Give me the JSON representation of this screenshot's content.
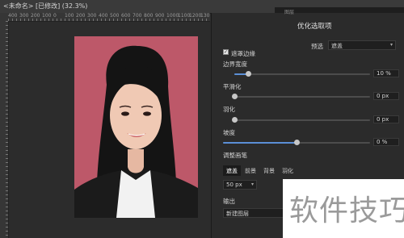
{
  "document": {
    "title": "<未命名> [已修改] (32.3%)"
  },
  "ruler": {
    "ticks": [
      "400",
      "300",
      "200",
      "100",
      "0",
      "100",
      "200",
      "300",
      "400",
      "500",
      "600",
      "700",
      "800",
      "900",
      "1000",
      "1100",
      "1200",
      "130"
    ]
  },
  "panel": {
    "tab_label": "图层"
  },
  "refine": {
    "title": "优化选取项",
    "preset_label": "预选",
    "preset_value": "遮盖",
    "matte_edges_label": "遮罩边缘",
    "matte_edges_checked": true,
    "sliders": [
      {
        "label": "边界宽度",
        "value_text": "10 %",
        "level": 0.1
      },
      {
        "label": "平滑化",
        "value_text": "0 px",
        "level": 0.0
      },
      {
        "label": "羽化",
        "value_text": "0 px",
        "level": 0.0
      },
      {
        "label": "坡度",
        "value_text": "0 %",
        "level": 0.5
      }
    ],
    "brush_label": "调整画笔",
    "brush_tabs": [
      {
        "label": "遮盖",
        "active": true
      },
      {
        "label": "前景",
        "active": false
      },
      {
        "label": "背景",
        "active": false
      },
      {
        "label": "羽化",
        "active": false
      }
    ],
    "brush_size": "50 px",
    "output_label": "输出",
    "output_value": "新建图层"
  },
  "watermark": {
    "text": "软件技巧"
  },
  "colors": {
    "accent": "#5b8fd6",
    "photo_background": "#bd5869",
    "panel": "#2b2b2b"
  }
}
